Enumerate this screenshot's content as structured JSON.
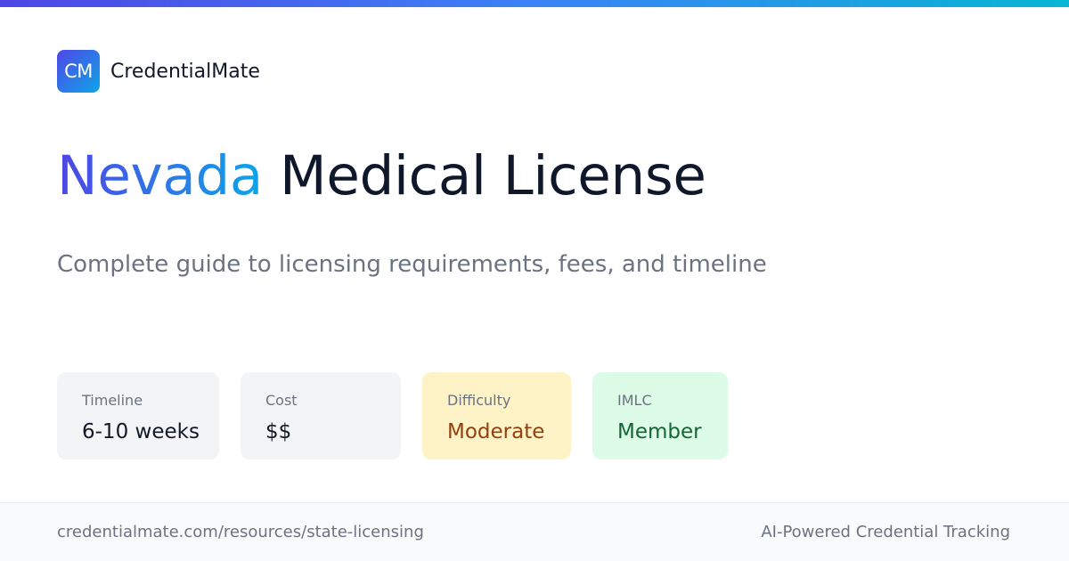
{
  "brand": {
    "logo_text": "CM",
    "name": "CredentialMate"
  },
  "hero": {
    "state": "Nevada",
    "title_rest": "Medical License",
    "subtitle": "Complete guide to licensing requirements, fees, and timeline"
  },
  "stats": [
    {
      "label": "Timeline",
      "value": "6-10 weeks"
    },
    {
      "label": "Cost",
      "value": "$$"
    },
    {
      "label": "Difficulty",
      "value": "Moderate"
    },
    {
      "label": "IMLC",
      "value": "Member"
    }
  ],
  "footer": {
    "url": "credentialmate.com/resources/state-licensing",
    "tagline": "AI-Powered Credential Tracking"
  },
  "colors": {
    "accent_start": "#4f46e5",
    "accent_end": "#0ea5e9",
    "moderate_bg": "#fef3c7",
    "moderate_text": "#92400e",
    "member_bg": "#dcfce7",
    "member_text": "#166534"
  }
}
